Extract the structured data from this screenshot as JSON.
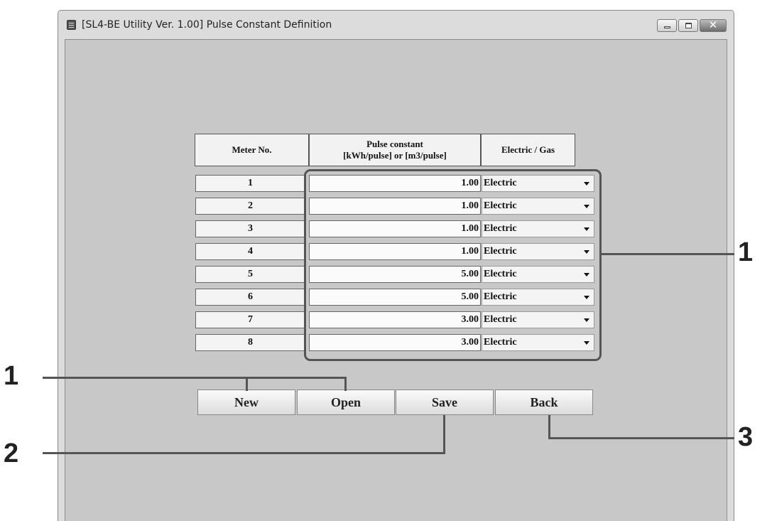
{
  "window": {
    "title": "[SL4-BE Utility Ver. 1.00]   Pulse Constant Definition",
    "controls": [
      "minimize",
      "maximize",
      "close"
    ]
  },
  "table": {
    "headers": {
      "meter_no": "Meter No.",
      "pulse_line1": "Pulse constant",
      "pulse_line2": "[kWh/pulse] or [m3/pulse]",
      "type": "Electric / Gas"
    },
    "rows": [
      {
        "meter": "1",
        "pulse": "1.00",
        "type": "Electric"
      },
      {
        "meter": "2",
        "pulse": "1.00",
        "type": "Electric"
      },
      {
        "meter": "3",
        "pulse": "1.00",
        "type": "Electric"
      },
      {
        "meter": "4",
        "pulse": "1.00",
        "type": "Electric"
      },
      {
        "meter": "5",
        "pulse": "5.00",
        "type": "Electric"
      },
      {
        "meter": "6",
        "pulse": "5.00",
        "type": "Electric"
      },
      {
        "meter": "7",
        "pulse": "3.00",
        "type": "Electric"
      },
      {
        "meter": "8",
        "pulse": "3.00",
        "type": "Electric"
      }
    ]
  },
  "buttons": {
    "new": "New",
    "open": "Open",
    "save": "Save",
    "back": "Back"
  },
  "callouts": {
    "table_highlight": "1",
    "new_open": "1",
    "save": "2",
    "back": "3"
  }
}
